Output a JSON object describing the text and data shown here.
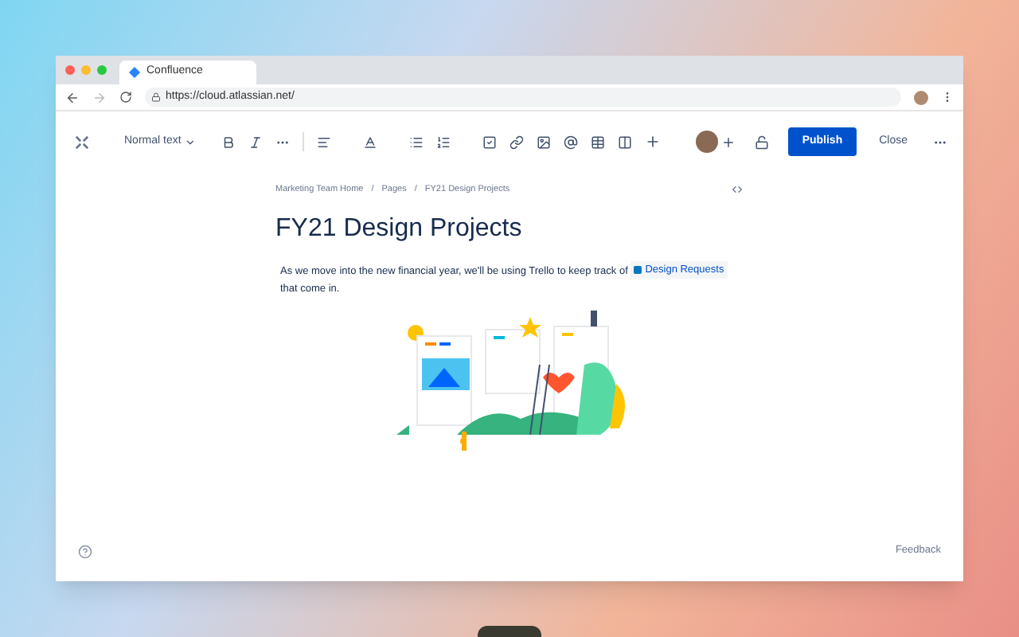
{
  "browser": {
    "tab_title": "Confluence",
    "url": "https://cloud.atlassian.net/"
  },
  "toolbar": {
    "text_style": "Normal text",
    "publish": "Publish",
    "close": "Close"
  },
  "breadcrumbs": {
    "separator": "/",
    "items": [
      "Marketing Team Home",
      "Pages",
      "FY21 Design Projects"
    ]
  },
  "page": {
    "title": "FY21 Design Projects",
    "body_text": "As we move into the new financial year, we'll be using Trello to keep track of",
    "link": "Design Requests",
    "body_text_end": "that come in."
  },
  "footer": {
    "feedback": "Feedback"
  }
}
